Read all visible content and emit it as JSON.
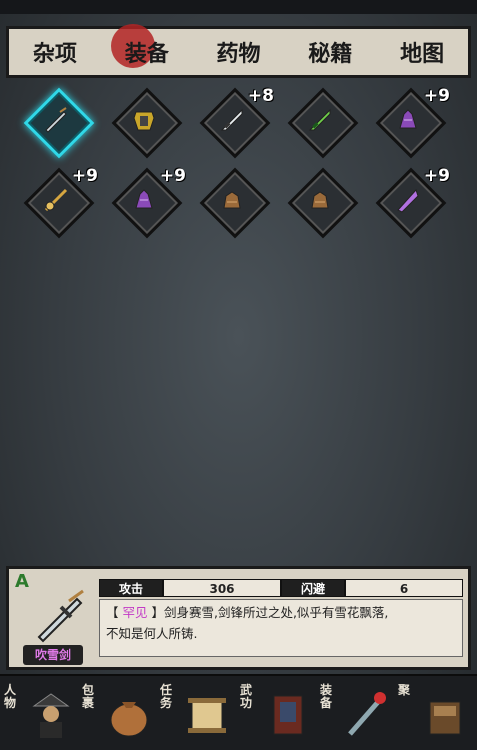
{
  "tabs": [
    {
      "label": "杂项",
      "active": false
    },
    {
      "label": "装备",
      "active": true
    },
    {
      "label": "药物",
      "active": false
    },
    {
      "label": "秘籍",
      "active": false
    },
    {
      "label": "地图",
      "active": false
    }
  ],
  "inventory": [
    {
      "icon": "dagger-icon",
      "level": "",
      "selected": true
    },
    {
      "icon": "armor-icon",
      "level": "",
      "selected": false
    },
    {
      "icon": "sword-icon",
      "level": "+8",
      "selected": false
    },
    {
      "icon": "green-sword-icon",
      "level": "",
      "selected": false
    },
    {
      "icon": "purple-gauntlet-icon",
      "level": "+9",
      "selected": false
    },
    {
      "icon": "hairpin-icon",
      "level": "+9",
      "selected": false
    },
    {
      "icon": "purple-gauntlet-icon",
      "level": "+9",
      "selected": false
    },
    {
      "icon": "bronze-gauntlet-icon",
      "level": "",
      "selected": false
    },
    {
      "icon": "bronze-gauntlet-icon",
      "level": "",
      "selected": false
    },
    {
      "icon": "purple-crystal-icon",
      "level": "+9",
      "selected": false
    }
  ],
  "detail": {
    "rank": "A",
    "name": "吹雪剑",
    "stat1_label": "攻击",
    "stat1_value": "306",
    "stat2_label": "闪避",
    "stat2_value": "6",
    "rarity": "罕见",
    "desc_line1_rest": "剑身赛雪,剑锋所过之处,似乎有雪花飘落,",
    "desc_line2": "不知是何人所铸."
  },
  "nav": [
    {
      "label": "人物",
      "icon": "character-icon"
    },
    {
      "label": "包裹",
      "icon": "bag-icon"
    },
    {
      "label": "任务",
      "icon": "scroll-icon"
    },
    {
      "label": "武功",
      "icon": "martial-book-icon"
    },
    {
      "label": "装备",
      "icon": "equipment-icon"
    },
    {
      "label": "聚",
      "icon": "gather-icon"
    }
  ],
  "colors": {
    "accent": "#30d8e8",
    "rare": "#c23ac6",
    "rank": "#2c7a2c"
  }
}
